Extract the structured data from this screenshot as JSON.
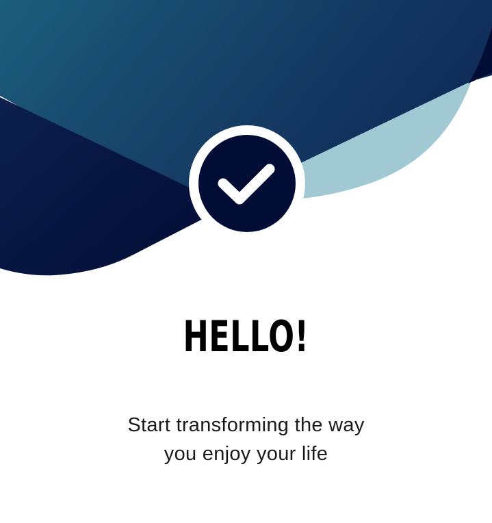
{
  "welcome": {
    "title": "HELLO!",
    "subtitle_line1": "Start transforming the way",
    "subtitle_line2": "you enjoy your life"
  },
  "badge": {
    "icon": "checkmark-icon"
  },
  "colors": {
    "navy": "#020d36",
    "teal": "#1c5a78",
    "light_teal": "#a1c9d4",
    "white": "#ffffff"
  }
}
